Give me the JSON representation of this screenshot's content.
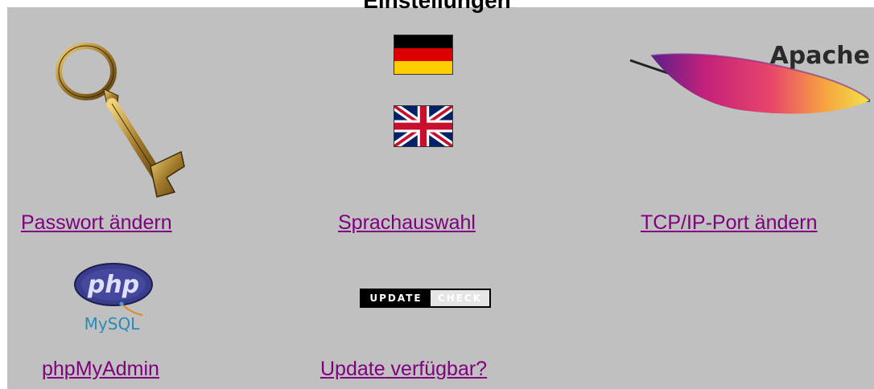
{
  "header": {
    "title": "Einstellungen"
  },
  "items": [
    {
      "label": "Passwort ändern",
      "icon": "key-icon"
    },
    {
      "label": "Sprachauswahl",
      "icon": "flag-icons"
    },
    {
      "label": "TCP/IP-Port ändern",
      "icon": "apache-feather-icon",
      "icon_text": "Apache"
    },
    {
      "label": "phpMyAdmin",
      "icon": "php-mysql-icon",
      "icon_text_php": "php",
      "icon_text_mysql": "MySQL"
    },
    {
      "label": "Update verfügbar?",
      "icon": "update-check-icon",
      "icon_text_left": "UPDATE",
      "icon_text_right": "CHECK"
    }
  ],
  "colors": {
    "panel": "#c0c0c0",
    "link": "#800080"
  }
}
